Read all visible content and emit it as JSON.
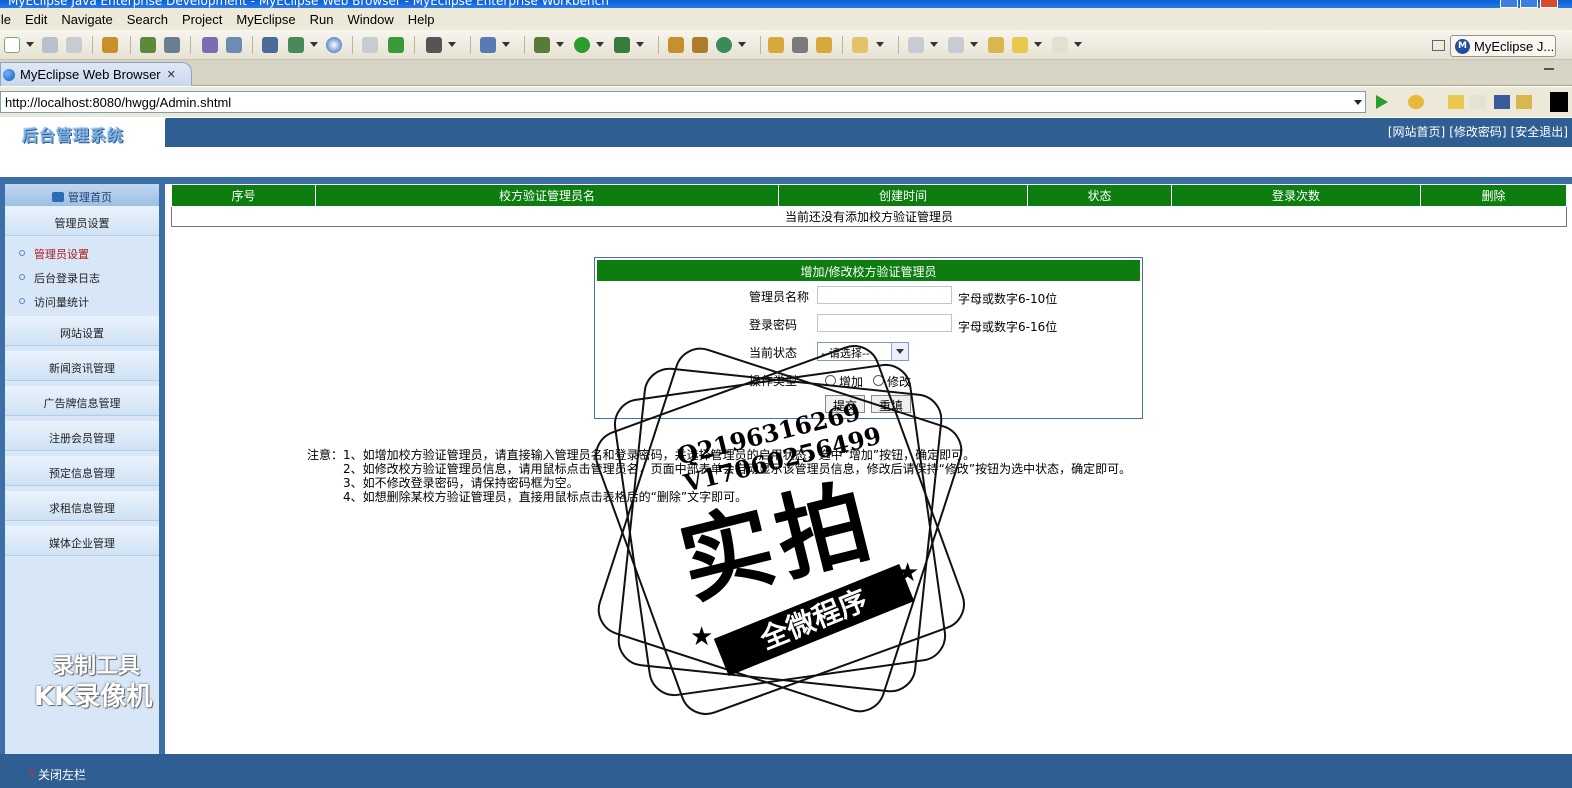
{
  "window": {
    "title": "MyEclipse Java Enterprise Development - MyEclipse Web Browser - MyEclipse Enterprise Workbench"
  },
  "menubar": [
    "ile",
    "Edit",
    "Navigate",
    "Search",
    "Project",
    "MyEclipse",
    "Run",
    "Window",
    "Help"
  ],
  "perspective": {
    "label": "MyEclipse J..."
  },
  "tab": {
    "title": "MyEclipse Web Browser",
    "close": "✕"
  },
  "url": {
    "value": "http://localhost:8080/hwgg/Admin.shtml"
  },
  "site": {
    "logo": "后台管理系统",
    "top_links": [
      "[网站首页]",
      "[修改密码]",
      "[安全退出]"
    ]
  },
  "nav": {
    "header": "管理首页",
    "groups": [
      {
        "label": "管理员设置"
      },
      {
        "label": "网站设置"
      },
      {
        "label": "新闻资讯管理"
      },
      {
        "label": "广告牌信息管理"
      },
      {
        "label": "注册会员管理"
      },
      {
        "label": "预定信息管理"
      },
      {
        "label": "求租信息管理"
      },
      {
        "label": "媒体企业管理"
      }
    ],
    "subitems": [
      {
        "label": "管理员设置",
        "active": true
      },
      {
        "label": "后台登录日志",
        "active": false
      },
      {
        "label": "访问量统计",
        "active": false
      }
    ],
    "close_left": "关闭左栏"
  },
  "table": {
    "columns": [
      "序号",
      "校方验证管理员名",
      "创建时间",
      "状态",
      "登录次数",
      "删除"
    ],
    "empty_message": "当前还没有添加校方验证管理员"
  },
  "form": {
    "title": "增加/修改校方验证管理员",
    "username_label": "管理员名称",
    "username_hint": "字母或数字6-10位",
    "password_label": "登录密码",
    "password_hint": "字母或数字6-16位",
    "status_label": "当前状态",
    "status_value": "--请选择--",
    "op_label": "操作类型",
    "op_add": "增加",
    "op_modify": "修改",
    "submit": "提交",
    "reset": "重填"
  },
  "notes": [
    "注意：1、如增加校方验证管理员，请直接输入管理员名和登录密码，并选择管理员的启用状态，选中“增加”按钮，确定即可。",
    "2、如修改校方验证管理员信息，请用鼠标点击管理员名，页面中部表单会自动显示该管理员信息，修改后请保持“修改”按钮为选中状态，确定即可。",
    "3、如不修改登录密码，请保持密码框为空。",
    "4、如想删除某校方验证管理员，直接用鼠标点击表格后的“删除”文字即可。"
  ],
  "watermark": {
    "qq": "Q2196316269",
    "v": "V17060256499",
    "big": "实拍",
    "bar": "全微程序",
    "recorder1": "录制工具",
    "recorder2": "KK录像机"
  },
  "colors": {
    "green": "#0d7d10",
    "nav_blue": "#2f5e93",
    "nav_panel": "#d7e7f8"
  }
}
